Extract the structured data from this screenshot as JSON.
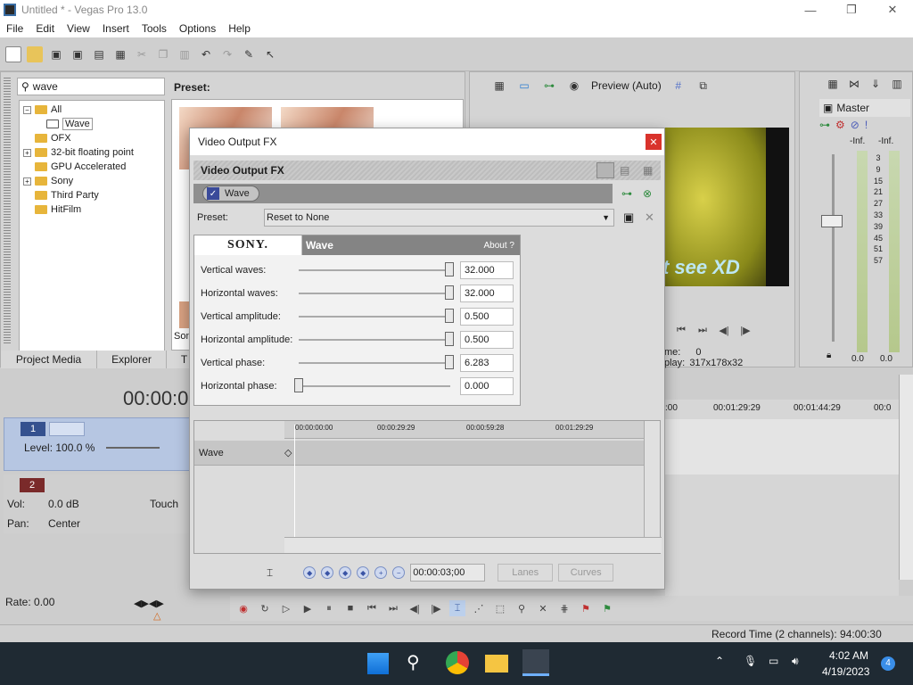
{
  "window": {
    "title": "Untitled * - Vegas Pro 13.0",
    "minimize": "—",
    "restore": "❐",
    "close": "✕"
  },
  "menu": [
    "File",
    "Edit",
    "View",
    "Insert",
    "Tools",
    "Options",
    "Help"
  ],
  "plugin_browser": {
    "search_value": "wave",
    "preset_label": "Preset:",
    "tree": [
      {
        "label": "All",
        "toggle": "−"
      },
      {
        "label": "Wave",
        "toggle": ""
      },
      {
        "label": "OFX",
        "toggle": ""
      },
      {
        "label": "32-bit floating point",
        "toggle": "+"
      },
      {
        "label": "GPU Accelerated",
        "toggle": ""
      },
      {
        "label": "Sony",
        "toggle": "+"
      },
      {
        "label": "Third Party",
        "toggle": ""
      },
      {
        "label": "HitFilm",
        "toggle": ""
      }
    ],
    "preset_caption": "Sony",
    "tabs": [
      "Project Media",
      "Explorer",
      "T"
    ]
  },
  "preview": {
    "mode": "Preview (Auto)",
    "overlay_text": "t see XD",
    "frame_label": "me:",
    "frame_value": "0",
    "display_label": "play:",
    "display_value": "317x178x32"
  },
  "master": {
    "title": "Master",
    "inf_left": "-Inf.",
    "inf_right": "-Inf.",
    "scale": [
      "3",
      "9",
      "15",
      "21",
      "27",
      "33",
      "39",
      "45",
      "51",
      "57"
    ],
    "val_left": "0.0",
    "val_right": "0.0"
  },
  "timecode": "00:00:00",
  "tracks": [
    {
      "number": "1",
      "level_label": "Level: 100.0 %"
    },
    {
      "number": "2",
      "vol_label": "Vol:",
      "vol_value": "0.0 dB",
      "pan_label": "Pan:",
      "pan_value": "Center",
      "touch": "Touch"
    }
  ],
  "timeline_ruler": [
    ":00",
    "00:01:29:29",
    "00:01:44:29",
    "00:0"
  ],
  "rate": "Rate: 0.00",
  "record_time": "Record Time (2 channels): 94:00:30",
  "dialog": {
    "title": "Video Output FX",
    "chain_title": "Video Output FX",
    "chip_label": "Wave",
    "preset_label": "Preset:",
    "preset_value": "Reset to None",
    "plugin_brand": "SONY.",
    "plugin_name": "Wave",
    "about": "About  ?",
    "params": [
      {
        "label": "Vertical waves:",
        "value": "32.000",
        "level": 1.0
      },
      {
        "label": "Horizontal waves:",
        "value": "32.000",
        "level": 1.0
      },
      {
        "label": "Vertical amplitude:",
        "value": "0.500",
        "level": 1.0
      },
      {
        "label": "Horizontal amplitude:",
        "value": "0.500",
        "level": 1.0
      },
      {
        "label": "Vertical phase:",
        "value": "6.283",
        "level": 1.0
      },
      {
        "label": "Horizontal phase:",
        "value": "0.000",
        "level": 0.0
      }
    ],
    "ruler": [
      "00:00:00:00",
      "00:00:29:29",
      "00:00:59:28",
      "00:01:29:29"
    ],
    "lane_label": "Wave",
    "cursor_time": "00:00:03;00",
    "lanes_btn": "Lanes",
    "curves_btn": "Curves"
  },
  "taskbar": {
    "time": "4:02 AM",
    "date": "4/19/2023",
    "badge": "4"
  }
}
